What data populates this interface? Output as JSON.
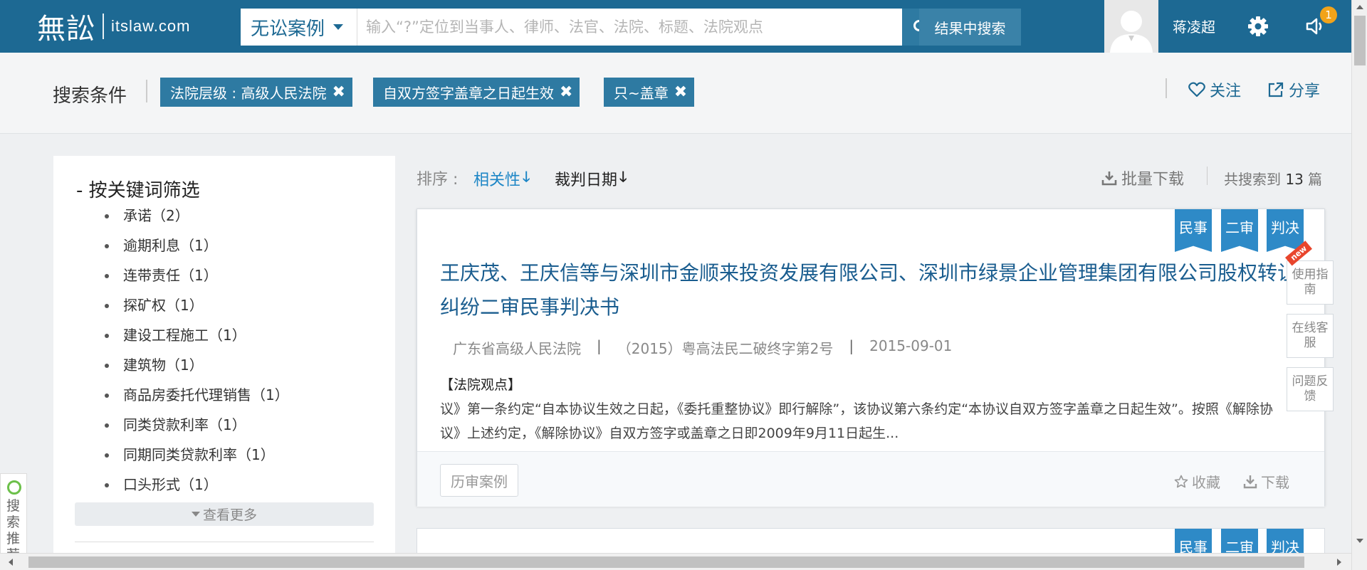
{
  "header": {
    "logo_mark": "無訟",
    "logo_text": "itslaw.com",
    "search_type": "无讼案例",
    "search_placeholder": "输入“?”定位到当事人、律师、法官、法院、标题、法院观点",
    "refine_button": "结果中搜索",
    "username": "蒋凌超",
    "notification_count": "1"
  },
  "filters": {
    "title": "搜索条件",
    "tags": [
      "法院层级 : 高级人民法院",
      "自双方签字盖章之日起生效",
      "只~盖章"
    ],
    "follow": "关注",
    "share": "分享"
  },
  "keyword_panel": {
    "title": "按关键词筛选",
    "items": [
      "承诺（2）",
      "逾期利息（1）",
      "连带责任（1）",
      "探矿权（1）",
      "建设工程施工（1）",
      "建筑物（1）",
      "商品房委托代理销售（1）",
      "同类贷款利率（1）",
      "同期同类贷款利率（1）",
      "口头形式（1）"
    ],
    "more": "查看更多"
  },
  "sort": {
    "label": "排序 :",
    "relevance": "相关性",
    "date": "裁判日期",
    "batch_download": "批量下载",
    "total_prefix": "共搜索到",
    "total_count": "13",
    "total_suffix": "篇"
  },
  "result": {
    "ribbons": [
      "民事",
      "二审",
      "判决"
    ],
    "title": "王庆茂、王庆信等与深圳市金顺来投资发展有限公司、深圳市绿景企业管理集团有限公司股权转让纠纷二审民事判决书",
    "court": "广东省高级人民法院",
    "case_no": "（2015）粤高法民二破终字第2号",
    "date": "2015-09-01",
    "section_label": "【法院观点】",
    "body": "议》第一条约定“自本协议生效之日起，《委托重整协议》即行解除”，该协议第六条约定“本协议自双方签字盖章之日起生效”。按照《解除协议》上述约定，《解除协议》自双方签字或盖章之日即2009年9月11日起生...",
    "history_button": "历审案例",
    "favorite": "收藏",
    "download": "下载"
  },
  "result2": {
    "ribbons": [
      "民事",
      "二审",
      "判决"
    ]
  },
  "side_buttons": {
    "new_tag": "new",
    "guide": "使用指南",
    "service": "在线客服",
    "feedback": "问题反馈"
  },
  "left_tab": "搜索推荐",
  "colors": {
    "header_bg": "#1d6993",
    "tag_bg": "#2e7aa2",
    "ribbon": "#2e8ac7",
    "title_link": "#1a5d8f",
    "badge": "#f2a31a"
  }
}
